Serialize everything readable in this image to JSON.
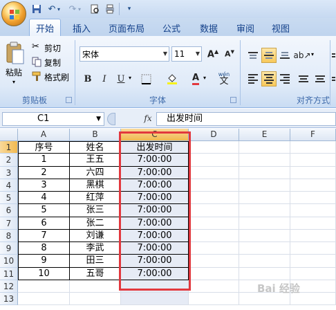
{
  "quick_access": [
    "save-icon",
    "undo-icon",
    "redo-icon",
    "print-preview-icon",
    "print-icon",
    "customize-icon"
  ],
  "tabs": [
    {
      "label": "开始",
      "active": true
    },
    {
      "label": "插入",
      "active": false
    },
    {
      "label": "页面布局",
      "active": false
    },
    {
      "label": "公式",
      "active": false
    },
    {
      "label": "数据",
      "active": false
    },
    {
      "label": "审阅",
      "active": false
    },
    {
      "label": "视图",
      "active": false
    }
  ],
  "clipboard": {
    "paste": "粘贴",
    "cut": "剪切",
    "copy": "复制",
    "format_painter": "格式刷",
    "group": "剪贴板"
  },
  "font": {
    "name": "宋体",
    "size": "11",
    "group": "字体",
    "bold": "B",
    "italic": "I",
    "underline": "U",
    "font_color": "A",
    "phonetic": "wén"
  },
  "alignment": {
    "group": "对齐方式"
  },
  "formula_bar": {
    "name_box": "C1",
    "fx": "fx",
    "content": "出发时间"
  },
  "columns": [
    "A",
    "B",
    "C",
    "D",
    "E",
    "F"
  ],
  "rows": [
    "1",
    "2",
    "3",
    "4",
    "5",
    "6",
    "7",
    "8",
    "9",
    "10",
    "11",
    "12",
    "13"
  ],
  "table": {
    "headers": [
      "序号",
      "姓名",
      "出发时间"
    ],
    "data": [
      [
        "1",
        "王五",
        "7:00:00"
      ],
      [
        "2",
        "六四",
        "7:00:00"
      ],
      [
        "3",
        "黑棋",
        "7:00:00"
      ],
      [
        "4",
        "红萍",
        "7:00:00"
      ],
      [
        "5",
        "张三",
        "7:00:00"
      ],
      [
        "6",
        "张二",
        "7:00:00"
      ],
      [
        "7",
        "刘谦",
        "7:00:00"
      ],
      [
        "8",
        "李武",
        "7:00:00"
      ],
      [
        "9",
        "田三",
        "7:00:00"
      ],
      [
        "10",
        "五哥",
        "7:00:00"
      ]
    ]
  },
  "watermark": "Bai 经验",
  "colors": {
    "accent": "#15428b",
    "selection": "#f1b94f",
    "highlight_border": "#e2383e"
  }
}
